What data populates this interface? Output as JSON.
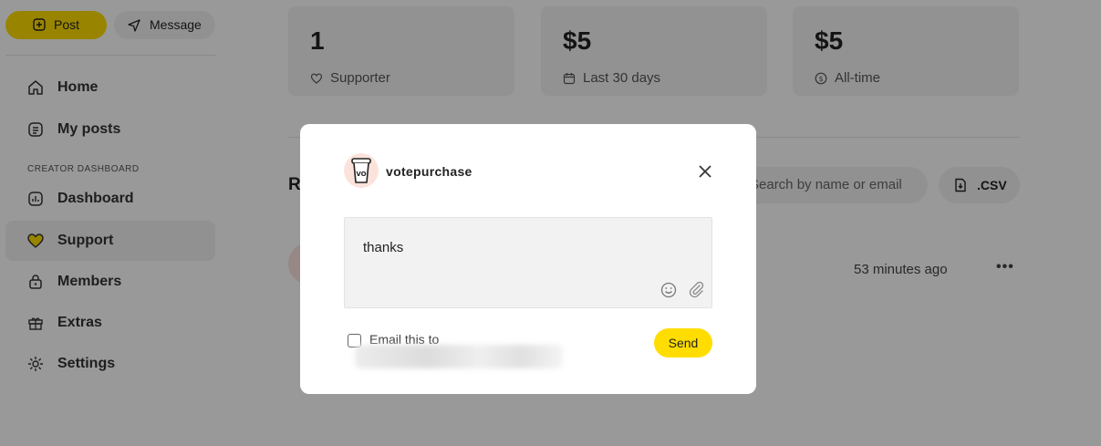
{
  "sidebar": {
    "post_label": "Post",
    "message_label": "Message",
    "items": [
      {
        "label": "Home",
        "icon": "home-icon"
      },
      {
        "label": "My posts",
        "icon": "posts-icon"
      },
      {
        "label": "Dashboard",
        "icon": "dashboard-icon"
      },
      {
        "label": "Support",
        "icon": "heart-icon",
        "active": true
      },
      {
        "label": "Members",
        "icon": "lock-icon"
      },
      {
        "label": "Extras",
        "icon": "gift-icon"
      },
      {
        "label": "Settings",
        "icon": "gear-icon"
      }
    ],
    "section_title": "CREATOR DASHBOARD"
  },
  "stats": [
    {
      "value": "1",
      "label": "Supporter",
      "icon": "heart-outline-icon"
    },
    {
      "value": "$5",
      "label": "Last 30 days",
      "icon": "calendar-icon"
    },
    {
      "value": "$5",
      "label": "All-time",
      "icon": "dollar-circle-icon"
    }
  ],
  "main": {
    "section_letter": "R",
    "search_placeholder": "Search by name or email",
    "csv_label": ".CSV",
    "row_time": "53 minutes ago",
    "row_more": "•••"
  },
  "modal": {
    "username": "votepurchase",
    "message_text": "thanks",
    "email_label": "Email this to",
    "email_checked": false,
    "send_label": "Send"
  },
  "colors": {
    "accent": "#ffdd00",
    "overlay": "rgba(0,0,0,0.4)"
  }
}
